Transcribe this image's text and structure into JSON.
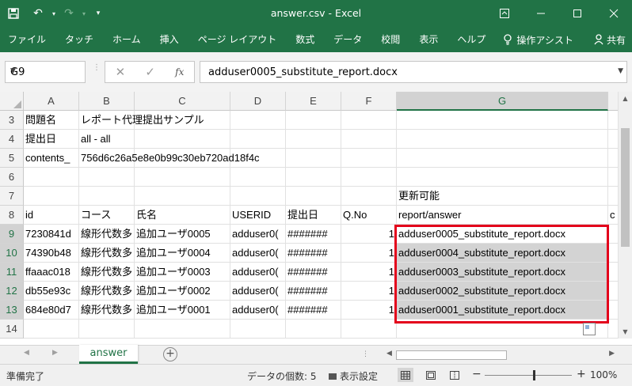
{
  "window": {
    "title": "answer.csv  -  Excel",
    "ribbon_display_icon": "ribbon-display-options-icon",
    "minimize_icon": "minimize-icon",
    "restore_icon": "restore-icon",
    "close_icon": "close-icon"
  },
  "qat": {
    "save_icon": "save-icon",
    "undo_icon": "undo-icon",
    "redo_icon": "redo-icon",
    "customize_icon": "customize-qat-icon"
  },
  "ribbon": {
    "tabs": [
      "ファイル",
      "タッチ",
      "ホーム",
      "挿入",
      "ページ レイアウト",
      "数式",
      "データ",
      "校閲",
      "表示",
      "ヘルプ"
    ],
    "tell_me": "操作アシスト",
    "share": "共有"
  },
  "formula_bar": {
    "name_box": "G9",
    "cancel_icon": "✕",
    "enter_icon": "✓",
    "fx_label": "fx",
    "content": "adduser0005_substitute_report.docx"
  },
  "grid": {
    "columns": [
      "A",
      "B",
      "C",
      "D",
      "E",
      "F",
      "G"
    ],
    "rows": [
      "3",
      "4",
      "5",
      "6",
      "7",
      "8",
      "9",
      "10",
      "11",
      "12",
      "13",
      "14"
    ],
    "r3": {
      "A": "問題名",
      "B": "レポート代理提出サンプル"
    },
    "r4": {
      "A": "提出日",
      "B": "all - all"
    },
    "r5": {
      "A": "contents_",
      "B": "756d6c26a5e8e0b99c30eb720ad18f4c"
    },
    "r7": {
      "G": "更新可能"
    },
    "r8": {
      "A": "id",
      "B": "コース",
      "C": "氏名",
      "D": "USERID",
      "E": "提出日",
      "F": "Q.No",
      "G": "report/answer",
      "H": "c"
    },
    "r9": {
      "A": "7230841d",
      "B": "線形代数多",
      "C": "追加ユーザ0005",
      "D": "adduser0(",
      "E": "#######",
      "F": "1",
      "G": "adduser0005_substitute_report.docx"
    },
    "r10": {
      "A": "74390b48",
      "B": "線形代数多",
      "C": "追加ユーザ0004",
      "D": "adduser0(",
      "E": "#######",
      "F": "1",
      "G": "adduser0004_substitute_report.docx"
    },
    "r11": {
      "A": "ffaaac018",
      "B": "線形代数多",
      "C": "追加ユーザ0003",
      "D": "adduser0(",
      "E": "#######",
      "F": "1",
      "G": "adduser0003_substitute_report.docx"
    },
    "r12": {
      "A": "db55e93c",
      "B": "線形代数多",
      "C": "追加ユーザ0002",
      "D": "adduser0(",
      "E": "#######",
      "F": "1",
      "G": "adduser0002_substitute_report.docx"
    },
    "r13": {
      "A": "684e80d7",
      "B": "線形代数多",
      "C": "追加ユーザ0001",
      "D": "adduser0(",
      "E": "#######",
      "F": "1",
      "G": "adduser0001_substitute_report.docx"
    }
  },
  "sheets": {
    "active": "answer",
    "add_icon": "+",
    "more_icon": "⋮"
  },
  "status": {
    "ready": "準備完了",
    "count": "データの個数: 5",
    "display_settings": "表示設定",
    "zoom": "100%"
  },
  "colors": {
    "accent": "#217346",
    "highlight_border": "#e3001b",
    "selection_fill": "#d3d3d3"
  }
}
